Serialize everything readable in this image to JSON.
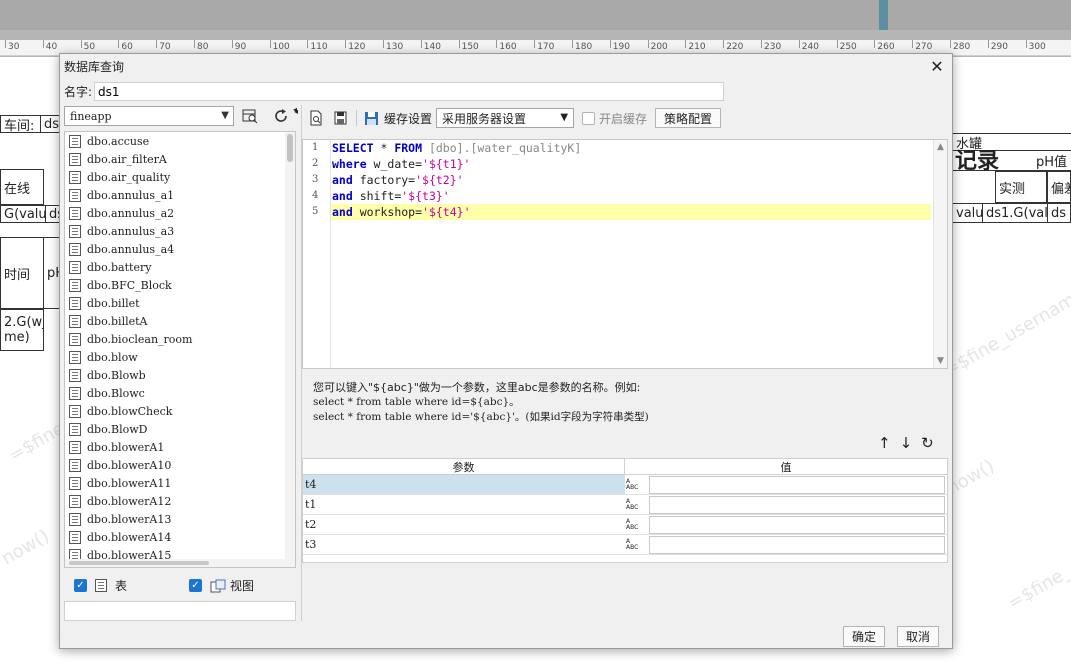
{
  "background": {
    "ruler_ticks": [
      "30",
      "40",
      "50",
      "60",
      "70",
      "80",
      "90",
      "100",
      "110",
      "120",
      "130",
      "140",
      "150",
      "160",
      "170",
      "180",
      "190",
      "200",
      "210",
      "220",
      "230",
      "240",
      "250",
      "260",
      "270",
      "280",
      "290",
      "300"
    ],
    "title_fragment": "记录",
    "cells": {
      "workshop_label": "车间:",
      "workshop_value": "ds",
      "water_tank": "水罐",
      "ph": "pH值",
      "line": "在线",
      "measured": "实测",
      "deviation": "偏差",
      "left_value": "G(valu",
      "left_value2": "ds",
      "right_value": "valu",
      "right_formula": "ds1.G(valu",
      "right_ds": "ds",
      "time": "时间",
      "ph_short": "pH",
      "w_formula": "2.G(w_",
      "me": "me)"
    },
    "watermarks": [
      "=$fine_username",
      "now()",
      "=$fine_username",
      "now()",
      "=$fine_"
    ]
  },
  "dialog": {
    "title": "数据库查询",
    "name_label": "名字:",
    "name_value": "ds1",
    "datasource": "fineapp",
    "tables": [
      "dbo.accuse",
      "dbo.air_filterA",
      "dbo.air_quality",
      "dbo.annulus_a1",
      "dbo.annulus_a2",
      "dbo.annulus_a3",
      "dbo.annulus_a4",
      "dbo.battery",
      "dbo.BFC_Block",
      "dbo.billet",
      "dbo.billetA",
      "dbo.bioclean_room",
      "dbo.blow",
      "dbo.Blowb",
      "dbo.Blowc",
      "dbo.blowCheck",
      "dbo.BlowD",
      "dbo.blowerA1",
      "dbo.blowerA10",
      "dbo.blowerA11",
      "dbo.blowerA12",
      "dbo.blowerA13",
      "dbo.blowerA14",
      "dbo.blowerA15"
    ],
    "check_table_label": "表",
    "check_view_label": "视图",
    "cache_label": "缓存设置",
    "cache_option": "采用服务器设置",
    "enable_cache_label": "开启缓存",
    "strategy_button": "策略配置",
    "sql_line_numbers": [
      "1",
      "2",
      "3",
      "4",
      "5"
    ],
    "sql": {
      "l1_kw1": "SELECT",
      "l1_star": " * ",
      "l1_kw2": "FROM",
      "l1_rest": " [dbo].[water_qualityK]",
      "l2_kw": "where",
      "l2_mid": " w_date=",
      "l2_str": "'${t1}'",
      "l3_kw": "and",
      "l3_mid": " factory=",
      "l3_str": "'${t2}'",
      "l4_kw": "and",
      "l4_mid": " shift=",
      "l4_str": "'${t3}'",
      "l5_kw": "and",
      "l5_mid": " workshop=",
      "l5_str": "'${t4}'"
    },
    "hint_line1": "您可以键入\"${abc}\"做为一个参数，这里abc是参数的名称。例如:",
    "hint_line2": "select * from table where id=${abc}。",
    "hint_line3": "select * from table where id='${abc}'。(如果id字段为字符串类型)",
    "param_header_name": "参数",
    "param_header_value": "值",
    "params": [
      {
        "name": "t4",
        "value": ""
      },
      {
        "name": "t1",
        "value": ""
      },
      {
        "name": "t2",
        "value": ""
      },
      {
        "name": "t3",
        "value": ""
      }
    ],
    "type_icon_text_a": "A",
    "type_icon_text_b": "ABC",
    "ok_button": "确定",
    "cancel_button": "取消"
  }
}
